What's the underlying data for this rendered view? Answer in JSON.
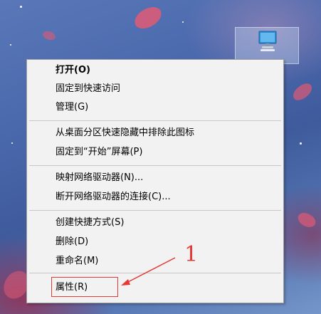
{
  "desktop": {
    "icon_name": "computer-icon"
  },
  "context_menu": {
    "groups": [
      {
        "items": [
          {
            "label": "打开(O)",
            "bold": true
          },
          {
            "label": "固定到快速访问"
          },
          {
            "label": "管理(G)"
          }
        ]
      },
      {
        "items": [
          {
            "label": "从桌面分区快速隐藏中排除此图标"
          },
          {
            "label": "固定到“开始”屏幕(P)"
          }
        ]
      },
      {
        "items": [
          {
            "label": "映射网络驱动器(N)..."
          },
          {
            "label": "断开网络驱动器的连接(C)..."
          }
        ]
      },
      {
        "items": [
          {
            "label": "创建快捷方式(S)"
          },
          {
            "label": "删除(D)"
          },
          {
            "label": "重命名(M)"
          }
        ]
      },
      {
        "items": [
          {
            "label": "属性(R)"
          }
        ]
      }
    ]
  },
  "annotation": {
    "number": "1",
    "color": "#e53935",
    "target": "属性(R)"
  }
}
